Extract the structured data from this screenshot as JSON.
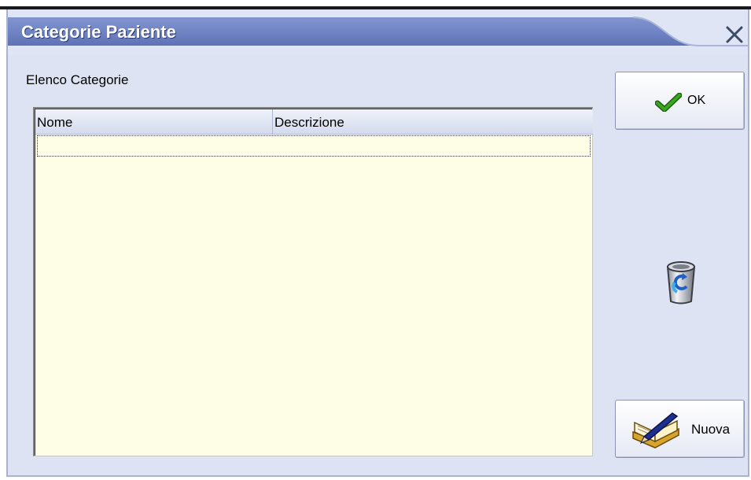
{
  "window": {
    "title": "Categorie Paziente",
    "close_icon": "close-icon",
    "colors": {
      "titlebar": "#6f82c3",
      "background": "#dde3f3",
      "list_background": "#fefee7"
    }
  },
  "list": {
    "label": "Elenco Categorie",
    "columns": [
      "Nome",
      "Descrizione"
    ],
    "rows": []
  },
  "buttons": {
    "ok_label": "OK",
    "ok_icon": "checkmark-icon",
    "refresh_icon": "recycle-bin-refresh-icon",
    "new_label": "Nuova",
    "new_icon": "book-pen-icon"
  }
}
